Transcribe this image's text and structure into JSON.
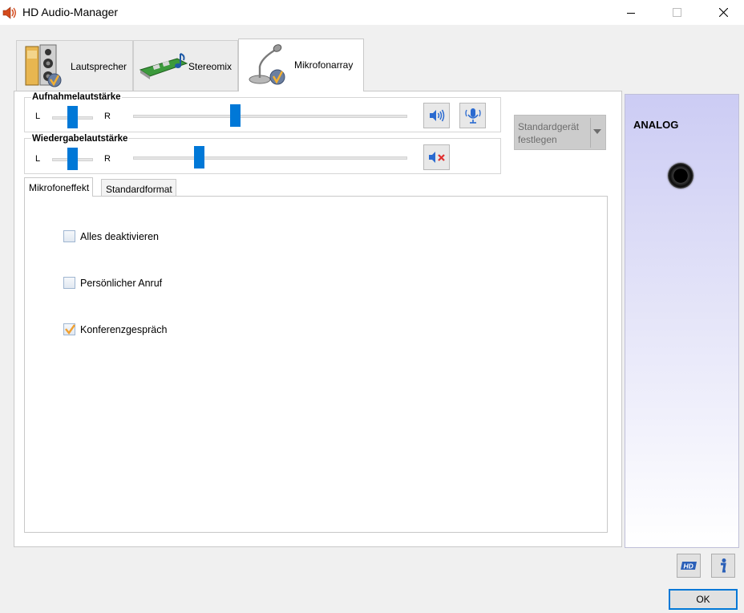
{
  "window": {
    "title": "HD Audio-Manager"
  },
  "tabs": [
    {
      "label": "Lautsprecher"
    },
    {
      "label": "Stereomix"
    },
    {
      "label": "Mikrofonarray"
    }
  ],
  "recording": {
    "title": "Aufnahmelautstärke",
    "left": "L",
    "right": "R",
    "balance_pct": 50,
    "volume_pct": 37
  },
  "playback": {
    "title": "Wiedergabelautstärke",
    "left": "L",
    "right": "R",
    "balance_pct": 50,
    "volume_pct": 23
  },
  "default_device": {
    "line1": "Standardgerät",
    "line2": "festlegen"
  },
  "subtabs": [
    {
      "label": "Mikrofoneffekt"
    },
    {
      "label": "Standardformat"
    }
  ],
  "effects": [
    {
      "label": "Alles deaktivieren",
      "checked": false
    },
    {
      "label": "Persönlicher Anruf",
      "checked": false
    },
    {
      "label": "Konferenzgespräch",
      "checked": true
    }
  ],
  "analog": {
    "title": "ANALOG"
  },
  "buttons": {
    "ok": "OK"
  },
  "colors": {
    "accent": "#0078d7",
    "check": "#f0a030",
    "mute_x": "#e03030"
  }
}
